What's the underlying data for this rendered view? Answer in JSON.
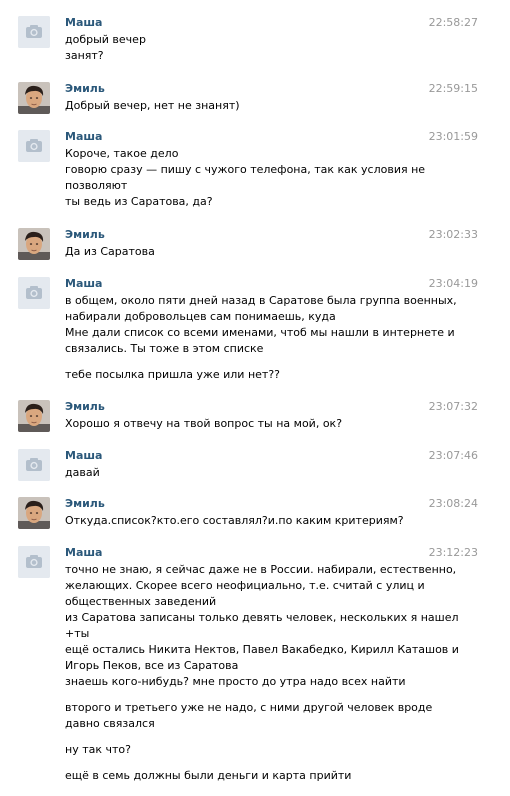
{
  "messages": [
    {
      "author": "Маша",
      "avatar": "camera-icon",
      "time": "22:58:27",
      "lines": [
        "добрый вечер",
        "занят?"
      ]
    },
    {
      "author": "Эмиль",
      "avatar": "user-photo",
      "time": "22:59:15",
      "lines": [
        "Добрый вечер, нет не знанят)"
      ]
    },
    {
      "author": "Маша",
      "avatar": "camera-icon",
      "time": "23:01:59",
      "lines": [
        "Короче, такое дело",
        "говорю сразу — пишу с чужого телефона, так как условия не",
        "позволяют",
        "ты ведь из Саратова, да?"
      ]
    },
    {
      "author": "Эмиль",
      "avatar": "user-photo",
      "time": "23:02:33",
      "lines": [
        "Да из Саратова"
      ]
    },
    {
      "author": "Маша",
      "avatar": "camera-icon",
      "time": "23:04:19",
      "lines": [
        "в общем, около пяти дней назад в Саратове была группа военных,",
        "набирали добровольцев сам понимаешь, куда",
        "Мне дали список со всеми именами, чтоб мы нашли в интернете и",
        "связались. Ты тоже в этом списке",
        "",
        "тебе посылка пришла уже или нет??"
      ]
    },
    {
      "author": "Эмиль",
      "avatar": "user-photo",
      "time": "23:07:32",
      "lines": [
        "Хорошо я отвечу на твой вопрос ты на мой, ок?"
      ]
    },
    {
      "author": "Маша",
      "avatar": "camera-icon",
      "time": "23:07:46",
      "lines": [
        "давай"
      ]
    },
    {
      "author": "Эмиль",
      "avatar": "user-photo",
      "time": "23:08:24",
      "lines": [
        "Откуда.список?кто.его составлял?и.по каким критериям?"
      ]
    },
    {
      "author": "Маша",
      "avatar": "camera-icon",
      "time": "23:12:23",
      "lines": [
        "точно не знаю, я сейчас даже не в России. набирали, естественно,",
        "желающих. Скорее всего неофициально, т.е. считай с улиц и",
        "общественных заведений",
        "из Саратова записаны только девять человек, нескольких я нашел",
        "+ты",
        "ещё остались Никита Нектов, Павел Вакабедко, Кирилл Каташов и",
        "Игорь Пеков, все из Саратова",
        "знаешь кого-нибудь? мне просто до утра надо всех найти",
        "",
        "второго и третьего уже не надо, с ними другой человек вроде",
        "давно связался",
        "",
        "ну так что?",
        "",
        "ещё в семь должны были деньги и карта прийти"
      ]
    }
  ]
}
